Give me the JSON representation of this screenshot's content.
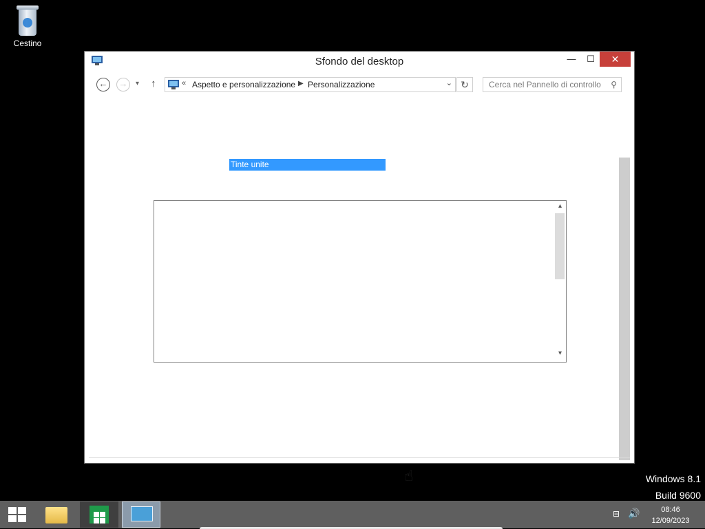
{
  "desktop": {
    "recycle_bin_label": "Cestino"
  },
  "window": {
    "title": "Sfondo del desktop",
    "minimize_glyph": "—",
    "maximize_glyph": "☐",
    "close_glyph": "✕"
  },
  "nav": {
    "back_glyph": "←",
    "forward_glyph": "→",
    "recent_glyph": "▾",
    "up_glyph": "↑",
    "overflow": "«",
    "breadcrumbs": [
      "Aspetto e personalizzazione",
      "Personalizzazione"
    ],
    "crumb_separator": "▶",
    "address_dropdown": "⌄",
    "refresh_glyph": "↻",
    "search_placeholder": "Cerca nel Pannello di controllo",
    "search_glyph": "⚲"
  },
  "content": {
    "picture_location_selected": "Tinte unite",
    "list_scroll_up": "▴",
    "list_scroll_down": "▾"
  },
  "watermark": {
    "line1": "Windows 8.1",
    "line2": "Build 9600"
  },
  "taskbar": {
    "apps": [
      "file-explorer",
      "windows-store",
      "control-panel"
    ],
    "time": "08:46",
    "date": "12/09/2023"
  },
  "colors": {
    "selection": "#3399ff",
    "close_button": "#c7403a",
    "taskbar": "#5f5f5f",
    "desktop": "#000000"
  }
}
